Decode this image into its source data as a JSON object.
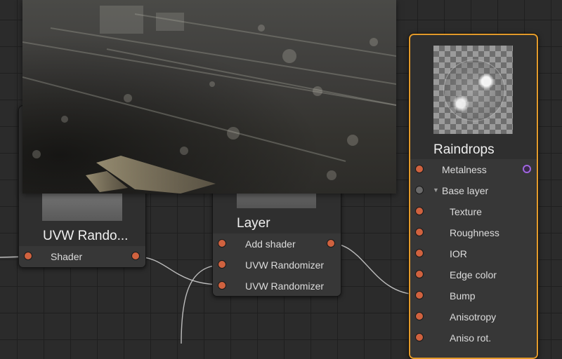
{
  "nodes": {
    "uvw": {
      "title": "UVW Rando...",
      "output_label": "Shader"
    },
    "layer": {
      "title": "Layer",
      "inputs": [
        "Add shader",
        "UVW Randomizer",
        "UVW Randomizer"
      ]
    },
    "raindrops": {
      "title": "Raindrops",
      "metalness": "Metalness",
      "base_layer": "Base layer",
      "inputs": [
        "Texture",
        "Roughness",
        "IOR",
        "Edge color",
        "Bump",
        "Anisotropy",
        "Aniso rot."
      ]
    }
  },
  "colors": {
    "canvas": "#2b2b2b",
    "port": "#d0623f",
    "selected_border": "#e39a2a",
    "metal_port": "#a065e0"
  },
  "icons": {
    "base_layer_caret": "▼"
  }
}
